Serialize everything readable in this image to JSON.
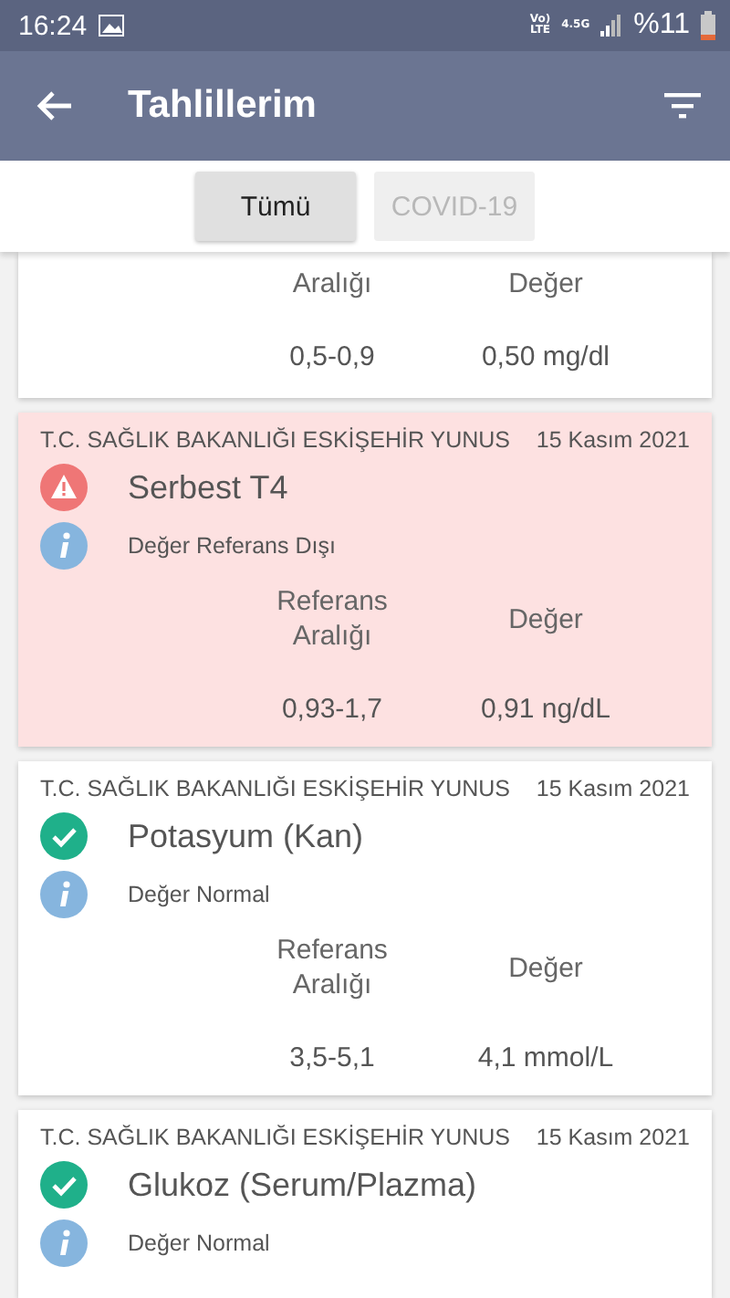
{
  "status_bar": {
    "time": "16:24",
    "volte": [
      "Vo)",
      "LTE"
    ],
    "network": "4.5G",
    "battery": "%11"
  },
  "app_bar": {
    "title": "Tahlillerim"
  },
  "filters": [
    {
      "label": "Tümü",
      "selected": true
    },
    {
      "label": "COVID-19",
      "selected": false
    }
  ],
  "results": [
    {
      "kind": "partial",
      "range_label": "Aralığı",
      "value_label": "Değer",
      "range": "0,5-0,9",
      "value": "0,50 mg/dl"
    },
    {
      "kind": "warning",
      "hospital": "T.C. SAĞLIK BAKANLIĞI ESKİŞEHİR YUNUS",
      "date": "15 Kasım 2021",
      "name": "Serbest T4",
      "status": "Değer Referans Dışı",
      "range_label": "Referans Aralığı",
      "value_label": "Değer",
      "range": "0,93-1,7",
      "value": "0,91 ng/dL"
    },
    {
      "kind": "normal",
      "hospital": "T.C. SAĞLIK BAKANLIĞI ESKİŞEHİR YUNUS",
      "date": "15 Kasım 2021",
      "name": "Potasyum (Kan)",
      "status": "Değer Normal",
      "range_label": "Referans Aralığı",
      "value_label": "Değer",
      "range": "3,5-5,1",
      "value": "4,1 mmol/L"
    },
    {
      "kind": "normal",
      "hospital": "T.C. SAĞLIK BAKANLIĞI ESKİŞEHİR YUNUS",
      "date": "15 Kasım 2021",
      "name": "Glukoz (Serum/Plazma)",
      "status": "Değer Normal"
    }
  ]
}
